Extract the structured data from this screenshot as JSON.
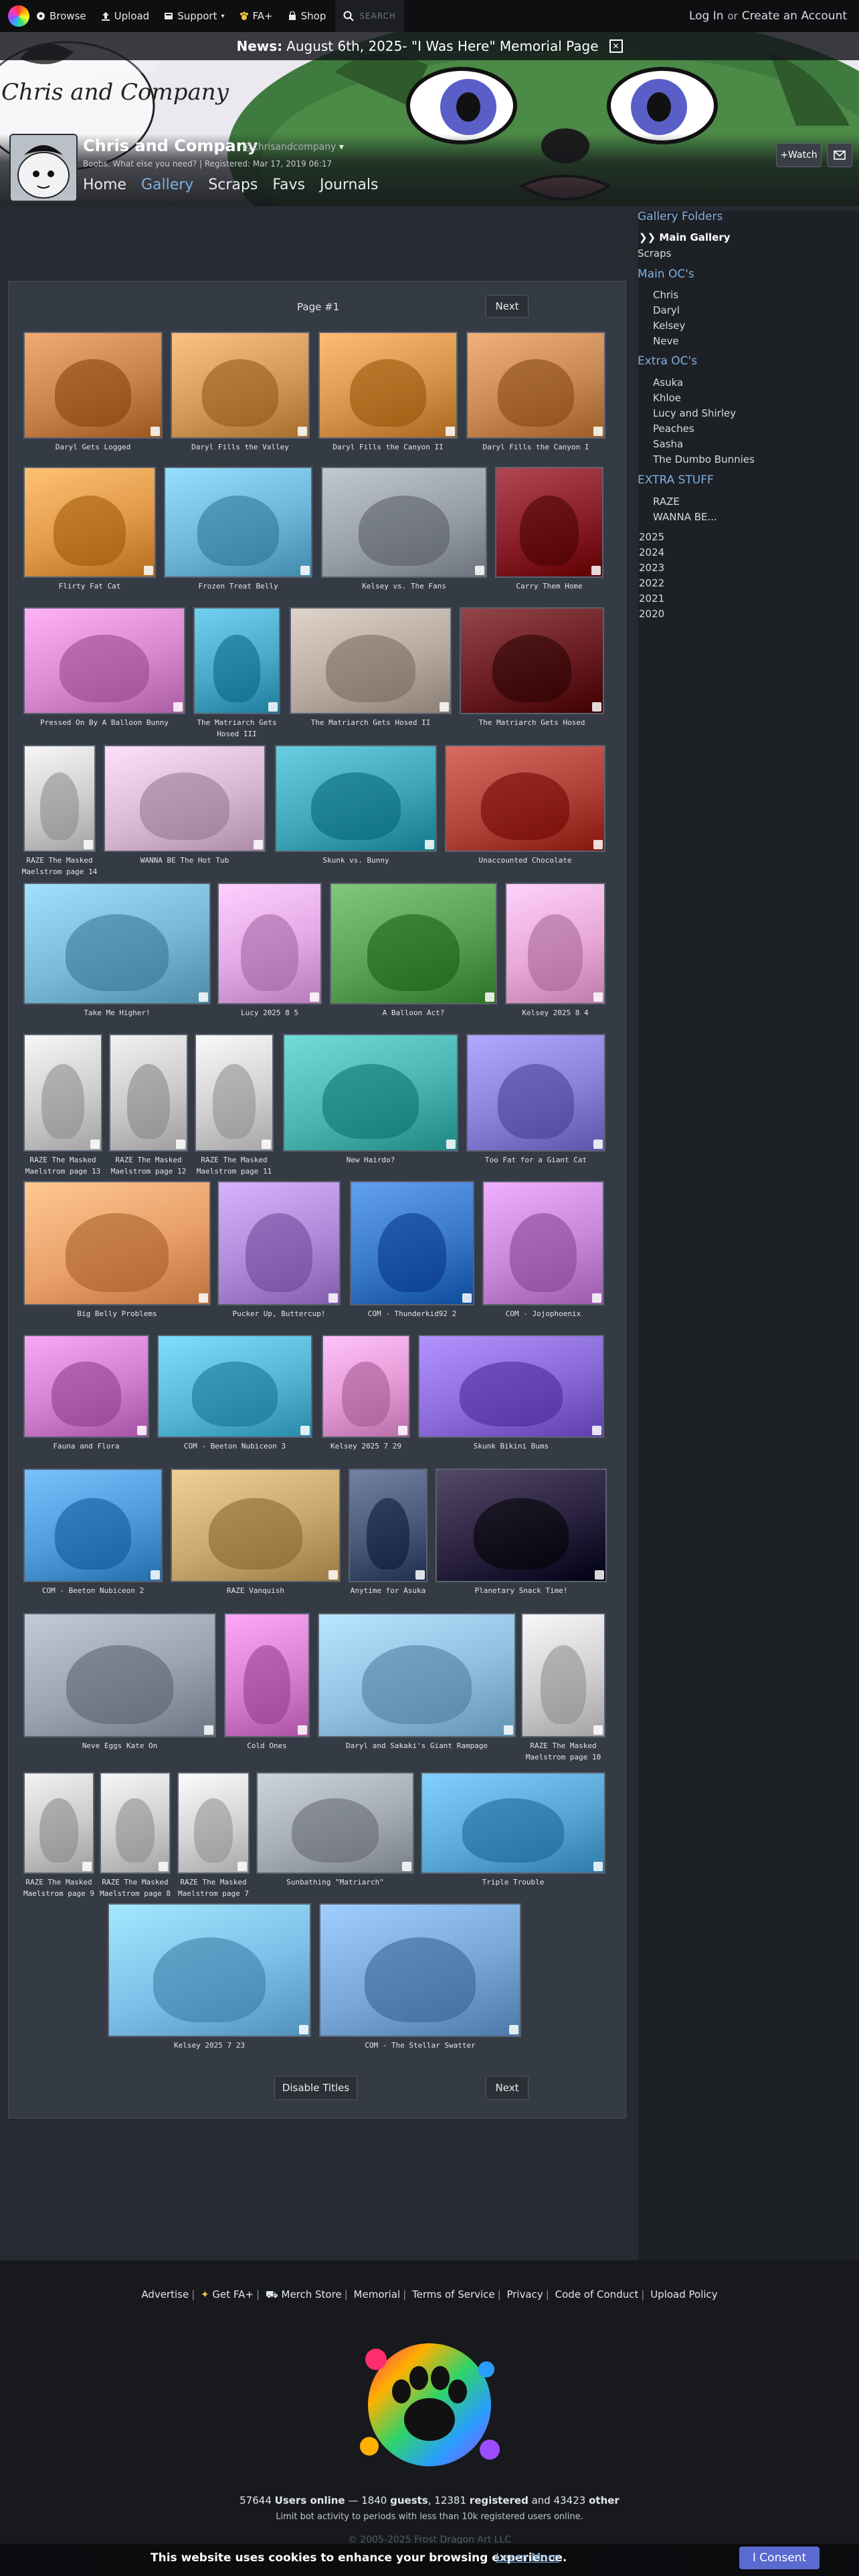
{
  "nav": {
    "browse": "Browse",
    "upload": "Upload",
    "support": "Support",
    "faplus": "FA+",
    "shop": "Shop",
    "search": "SEARCH",
    "login": "Log In",
    "or": "or",
    "create": "Create an Account"
  },
  "banner": {
    "news_label": "News:",
    "news_text": "August 6th, 2025- \"I Was Here\" Memorial Page",
    "banner_logo_text": "Chris and Company"
  },
  "profile": {
    "username": "Chris and Company",
    "handle": "@chrisandcompany",
    "subtitle": "Boobs. What else you need? | Registered: Mar 17, 2019 06:17",
    "watch": "+Watch"
  },
  "tabs": [
    {
      "label": "Home"
    },
    {
      "label": "Gallery"
    },
    {
      "label": "Scraps"
    },
    {
      "label": "Favs"
    },
    {
      "label": "Journals"
    }
  ],
  "sidebar": {
    "heading_folders": "Gallery Folders",
    "main_gallery": "❯❯ Main Gallery",
    "scraps": "Scraps",
    "heading_main_ocs": "Main OC's",
    "main_ocs": [
      "Chris",
      "Daryl",
      "Kelsey",
      "Neve"
    ],
    "heading_extra_ocs": "Extra OC's",
    "extra_ocs": [
      "Asuka",
      "Khloe",
      "Lucy and Shirley",
      "Peaches",
      "Sasha",
      "The Dumbo Bunnies"
    ],
    "heading_extra_stuff": "EXTRA STUFF",
    "extra_stuff": [
      "RAZE",
      "WANNA BE..."
    ],
    "years": [
      "2025",
      "2024",
      "2023",
      "2022",
      "2021",
      "2020"
    ]
  },
  "gallery": {
    "page_label": "Page #1",
    "next": "Next",
    "disable_titles": "Disable Titles",
    "rows": [
      [
        {
          "title": "Daryl Gets Logged",
          "bg": "#c9834a"
        },
        {
          "title": "Daryl Fills the Valley",
          "bg": "#d49a5a"
        },
        {
          "title": "Daryl Fills the Canyon II",
          "bg": "#d8944a"
        },
        {
          "title": "Daryl Fills the Canyon I",
          "bg": "#c88a52"
        }
      ],
      [
        {
          "title": "Flirty Fat Cat",
          "bg": "#e19a4a"
        },
        {
          "title": "Frozen Treat Belly",
          "bg": "#6fb7d8"
        },
        {
          "title": "Kelsey vs. The Fans",
          "bg": "#9aa0aa"
        },
        {
          "title": "Carry Them Home",
          "bg": "#8a1e2a"
        }
      ],
      [
        {
          "title": "Pressed On By A Balloon Bunny",
          "bg": "#d88ad0"
        },
        {
          "title": "The Matriarch Gets Hosed III",
          "bg": "#4aa9c9"
        },
        {
          "title": "The Matriarch Gets Hosed II",
          "bg": "#b8aca2"
        },
        {
          "title": "The Matriarch Gets Hosed",
          "bg": "#6b1e22"
        }
      ],
      [
        {
          "title": "RAZE The Masked Maelstrom page 14",
          "bg": "#cfcfcf"
        },
        {
          "title": "WANNA BE The Hot Tub",
          "bg": "#d9b8d4"
        },
        {
          "title": "Skunk vs. Bunny",
          "bg": "#3fa7b9"
        },
        {
          "title": "Unaccounted Chocolate",
          "bg": "#b0443a"
        }
      ],
      [
        {
          "title": "Take Me Higher!",
          "bg": "#7ab9d6"
        },
        {
          "title": "Lucy 2025 8 5",
          "bg": "#e2a8e6"
        },
        {
          "title": "A Balloon Act?",
          "bg": "#5aa052"
        },
        {
          "title": "Kelsey 2025 8 4",
          "bg": "#e8a9d6"
        }
      ],
      [
        {
          "title": "RAZE The Masked Maelstrom page 13",
          "bg": "#cfcfcf"
        },
        {
          "title": "RAZE The Masked Maelstrom page 12",
          "bg": "#cacaca"
        },
        {
          "title": "RAZE The Masked Maelstrom page 11",
          "bg": "#d2d2d2"
        },
        {
          "title": "New Hairdo?",
          "bg": "#4ab5b0"
        },
        {
          "title": "Too Fat for a Giant Cat",
          "bg": "#8a80d8"
        }
      ],
      [
        {
          "title": "Big Belly Problems",
          "bg": "#e9a06a"
        },
        {
          "title": "Pucker Up, Buttercup!",
          "bg": "#b08ad8"
        },
        {
          "title": "COM - Thunderkid92 2",
          "bg": "#3a78c9"
        },
        {
          "title": "COM - Jojophoenix",
          "bg": "#c888d9"
        }
      ],
      [
        {
          "title": "Fauna and Flora",
          "bg": "#d27fd0"
        },
        {
          "title": "COM - Beeton Nubiceon 3",
          "bg": "#56b6d6"
        },
        {
          "title": "Kelsey 2025 7 29",
          "bg": "#e49ad4"
        },
        {
          "title": "Skunk Bikini Bums",
          "bg": "#8a6bd8"
        }
      ],
      [
        {
          "title": "COM - Beeton Nubiceon 2",
          "bg": "#4f9ad8"
        },
        {
          "title": "RAZE Vanquish",
          "bg": "#c9a870"
        },
        {
          "title": "Anytime for Asuka",
          "bg": "#4a5a7a"
        },
        {
          "title": "Planetary Snack Time!",
          "bg": "#2a2240"
        }
      ],
      [
        {
          "title": "Neve Eggs Kate On",
          "bg": "#9aa4b0"
        },
        {
          "title": "Cold Ones",
          "bg": "#d87fd0"
        },
        {
          "title": "Daryl and Sakaki's Giant Rampage",
          "bg": "#8fc0e0"
        },
        {
          "title": "RAZE The Masked Maelstrom page 10",
          "bg": "#d0d0d0"
        }
      ],
      [
        {
          "title": "RAZE The Masked Maelstrom page 9",
          "bg": "#cbcbcb"
        },
        {
          "title": "RAZE The Masked Maelstrom page 8",
          "bg": "#cfcfcf"
        },
        {
          "title": "RAZE The Masked Maelstrom page 7",
          "bg": "#d4d4d4"
        },
        {
          "title": "Sunbathing \"Matriarch\"",
          "bg": "#a6acb4"
        },
        {
          "title": "Triple Trouble",
          "bg": "#5aa8d6"
        }
      ],
      [
        {
          "title": "Kelsey 2025 7 23",
          "bg": "#7cc0e8"
        },
        {
          "title": "COM - The Stellar Swatter",
          "bg": "#78a6d6"
        }
      ]
    ]
  },
  "footer": {
    "links": [
      "Advertise",
      "Get FA+",
      "Merch Store",
      "Memorial",
      "Terms of Service",
      "Privacy",
      "Code of Conduct",
      "Upload Policy"
    ],
    "stats_online": "57644",
    "stats_online_label": "Users online",
    "stats_guests": "1840",
    "stats_guests_label": "guests",
    "stats_registered": "12381",
    "stats_registered_label": "registered",
    "stats_other": "43423",
    "stats_other_label": "other",
    "stats_sub": "Limit bot activity to periods with less than 10k registered users online.",
    "copyright": "© 2005-2025 Frost Dragon Art LLC"
  },
  "cookie": {
    "text": "This website uses cookies to enhance your browsing experience.",
    "link": "Learn More",
    "button": "I Consent"
  }
}
